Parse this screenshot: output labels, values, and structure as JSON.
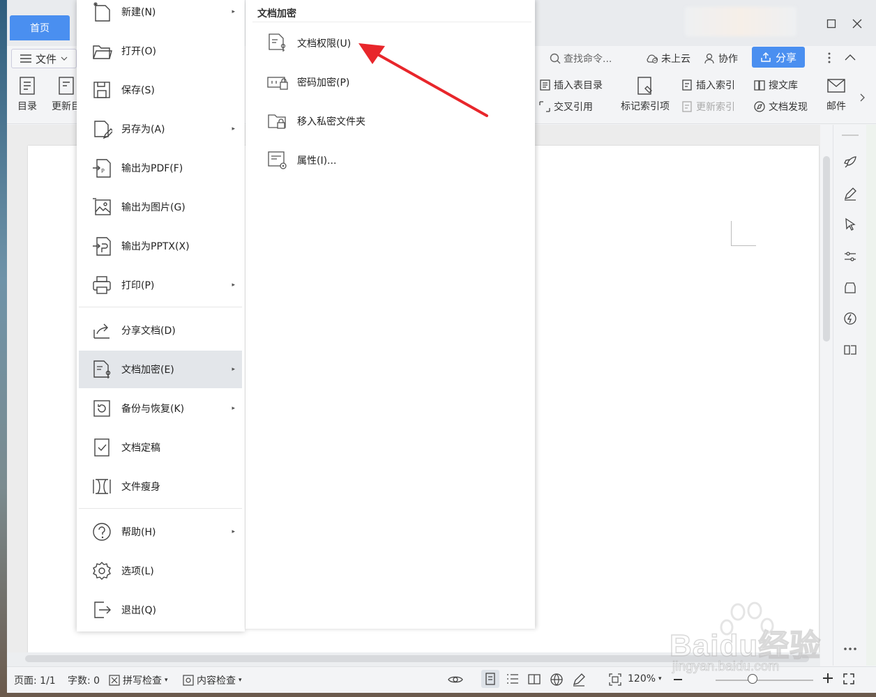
{
  "titlebar": {
    "home_tab": "首页"
  },
  "menubar": {
    "file_label": "文件",
    "search_placeholder": "查找命令...",
    "cloud": "未上云",
    "collab": "协作",
    "share": "分享"
  },
  "ribbon": {
    "toc": "目录",
    "update": "更新目",
    "insert_table_toc": "插入表目录",
    "cross_ref": "交叉引用",
    "mark_index": "标记索引项",
    "insert_index": "插入索引",
    "update_index": "更新索引",
    "search_lib": "搜文库",
    "doc_discover": "文档发现",
    "mail": "邮件"
  },
  "file_menu": {
    "items": [
      {
        "label": "新建(N)",
        "icon": "new-icon",
        "submenu": true
      },
      {
        "label": "打开(O)",
        "icon": "folder-open-icon",
        "submenu": false
      },
      {
        "label": "保存(S)",
        "icon": "save-icon",
        "submenu": false
      },
      {
        "label": "另存为(A)",
        "icon": "save-as-icon",
        "submenu": true
      },
      {
        "label": "输出为PDF(F)",
        "icon": "export-pdf-icon",
        "submenu": false
      },
      {
        "label": "输出为图片(G)",
        "icon": "export-image-icon",
        "submenu": false
      },
      {
        "label": "输出为PPTX(X)",
        "icon": "export-pptx-icon",
        "submenu": false
      },
      {
        "label": "打印(P)",
        "icon": "print-icon",
        "submenu": true
      },
      {
        "label": "分享文档(D)",
        "icon": "share-doc-icon",
        "submenu": false
      },
      {
        "label": "文档加密(E)",
        "icon": "doc-encrypt-icon",
        "submenu": true,
        "active": true
      },
      {
        "label": "备份与恢复(K)",
        "icon": "backup-icon",
        "submenu": true
      },
      {
        "label": "文档定稿",
        "icon": "finalize-icon",
        "submenu": false
      },
      {
        "label": "文件瘦身",
        "icon": "slim-icon",
        "submenu": false
      },
      {
        "label": "帮助(H)",
        "icon": "help-icon",
        "submenu": true
      },
      {
        "label": "选项(L)",
        "icon": "gear-icon",
        "submenu": false
      },
      {
        "label": "退出(Q)",
        "icon": "exit-icon",
        "submenu": false
      }
    ]
  },
  "sub_menu": {
    "title": "文档加密",
    "items": [
      {
        "label": "文档权限(U)",
        "icon": "doc-permission-icon"
      },
      {
        "label": "密码加密(P)",
        "icon": "password-icon"
      },
      {
        "label": "移入私密文件夹",
        "icon": "private-folder-icon"
      },
      {
        "label": "属性(I)...",
        "icon": "properties-icon"
      }
    ]
  },
  "status": {
    "page": "页面: 1/1",
    "words": "字数: 0",
    "spell": "拼写检查",
    "content": "内容检查",
    "zoom": "120%"
  },
  "watermark": {
    "brand": "Baidu经验",
    "url": "jingyan.baidu.com"
  },
  "colors": {
    "accent": "#4a8ff0",
    "annotation_arrow": "#e8262b"
  }
}
